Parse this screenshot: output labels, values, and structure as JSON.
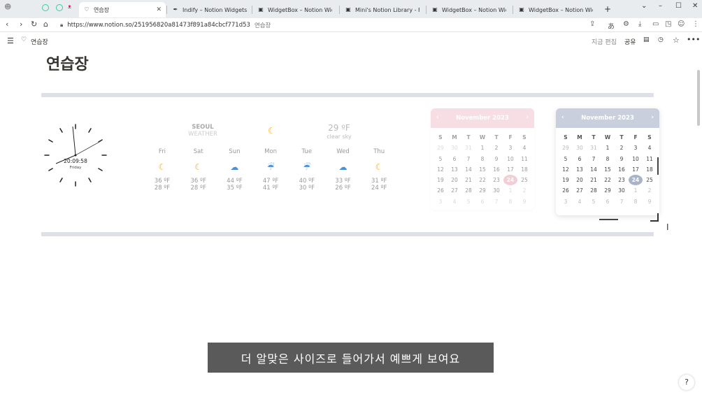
{
  "browser": {
    "tabs": [
      {
        "label": "연습장",
        "active": true
      },
      {
        "label": "Indify – Notion Widgets"
      },
      {
        "label": "WidgetBox – Notion Widgets"
      },
      {
        "label": "Mini's Notion Library - Free Notion Temp…"
      },
      {
        "label": "WidgetBox – Notion Widgets"
      },
      {
        "label": "WidgetBox – Notion Widgets"
      }
    ],
    "new_tab": "+",
    "url": "https://www.notion.so/251956820a81473f891a84cbcf771d53",
    "url_title": "연습장"
  },
  "notion": {
    "breadcrumb": "연습장",
    "edited": "지금 편집",
    "share": "공유",
    "title": "연습장"
  },
  "clock": {
    "time": "20:09:58",
    "day": "Friday"
  },
  "weather": {
    "city": "SEOUL",
    "label": "WEATHER",
    "current_temp": "29 ºF",
    "current_desc": "clear sky",
    "days": [
      {
        "day": "Fri",
        "icon": "moon-icon",
        "high": "36 ºF",
        "low": "28 ºF"
      },
      {
        "day": "Sat",
        "icon": "moon-icon",
        "high": "36 ºF",
        "low": "28 ºF"
      },
      {
        "day": "Sun",
        "icon": "cloud-sun-icon",
        "high": "44 ºF",
        "low": "35 ºF"
      },
      {
        "day": "Mon",
        "icon": "rain-icon",
        "high": "47 ºF",
        "low": "41 ºF"
      },
      {
        "day": "Tue",
        "icon": "rain-icon",
        "high": "40 ºF",
        "low": "30 ºF"
      },
      {
        "day": "Wed",
        "icon": "cloud-sun-icon",
        "high": "33 ºF",
        "low": "26 ºF"
      },
      {
        "day": "Thu",
        "icon": "moon-icon",
        "high": "31 ºF",
        "low": "24 ºF"
      }
    ]
  },
  "calendars": [
    {
      "month": "November 2023",
      "accent": "#f0c4cf",
      "today_color": "#e8a8b8",
      "faded": true
    },
    {
      "month": "November 2023",
      "accent": "#c9cfdd",
      "today_color": "#aab4c8",
      "faded": false
    }
  ],
  "calendar_days": {
    "headers": [
      "S",
      "M",
      "T",
      "W",
      "T",
      "F",
      "S"
    ],
    "cells": [
      "29",
      "30",
      "31",
      "1",
      "2",
      "3",
      "4",
      "5",
      "6",
      "7",
      "8",
      "9",
      "10",
      "11",
      "12",
      "13",
      "14",
      "15",
      "16",
      "17",
      "18",
      "19",
      "20",
      "21",
      "22",
      "23",
      "24",
      "25",
      "26",
      "27",
      "28",
      "29",
      "30",
      "1",
      "2",
      "3",
      "4",
      "5",
      "6",
      "7",
      "8",
      "9"
    ],
    "today": "24"
  },
  "subtitle": "더 알맞은 사이즈로 들어가서 예쁘게 보여요",
  "help": "?"
}
